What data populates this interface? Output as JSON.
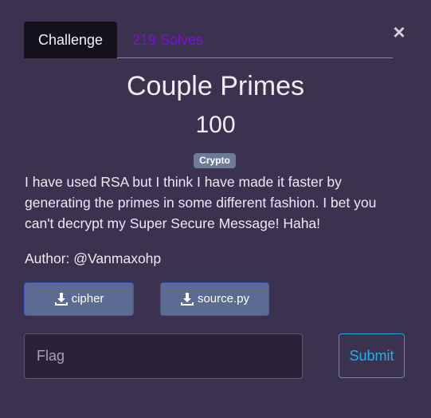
{
  "tabs": {
    "challenge_label": "Challenge",
    "solves_label": "219 Solves"
  },
  "close_glyph": "×",
  "challenge": {
    "name": "Couple Primes",
    "points": "100",
    "category": "Crypto",
    "description": "I have used RSA but I think I have made it faster by generating the primes in some different fashion. I bet you can't decrypt my Super Secure Message! Haha!",
    "author": "Author: @Vanmaxohp"
  },
  "files": [
    {
      "label": "cipher",
      "icon": "download-icon"
    },
    {
      "label": "source.py",
      "icon": "download-icon"
    }
  ],
  "form": {
    "flag_placeholder": "Flag",
    "flag_value": "",
    "submit_label": "Submit"
  },
  "colors": {
    "background": "#3b3250",
    "solves_tab": "#7d10d0",
    "badge": "#6d7b96",
    "file_button": "#5b6b92",
    "submit_accent": "#1fa8e0"
  }
}
